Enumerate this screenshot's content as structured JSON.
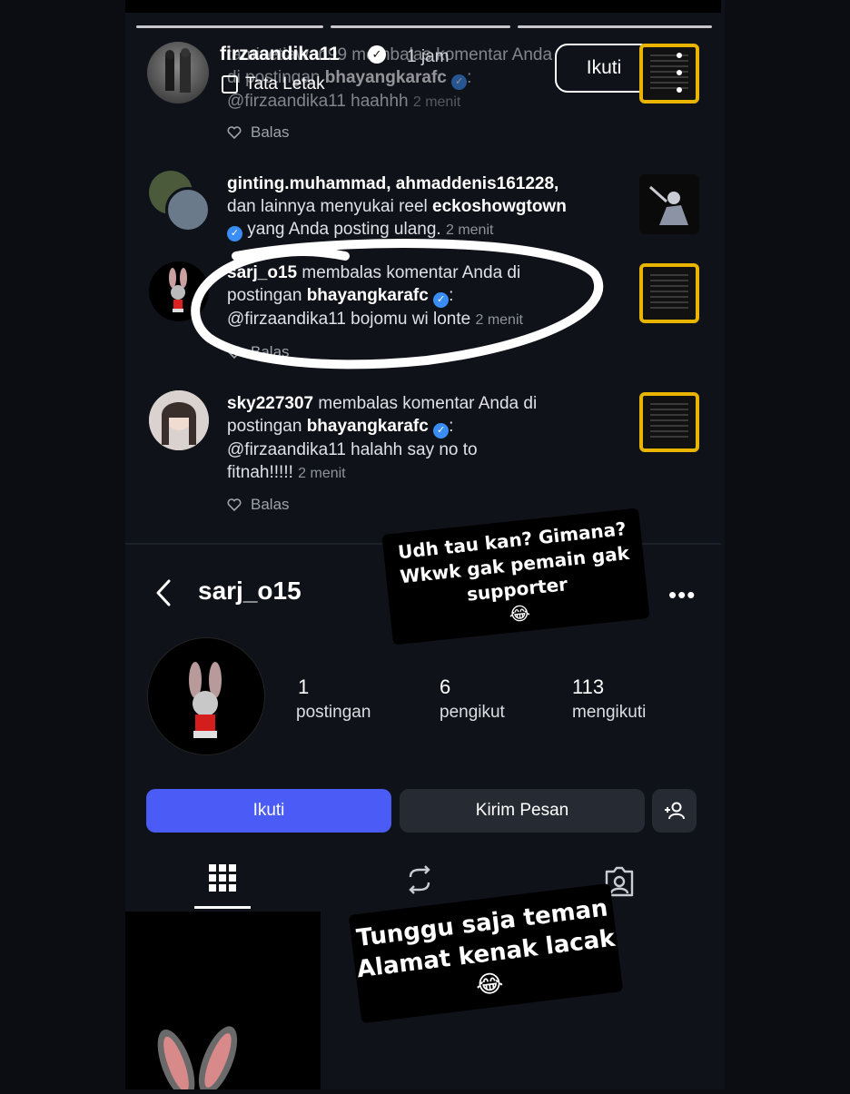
{
  "notifications": [
    {
      "overlay_username": "firzaandika11",
      "overlay_time": "1 jam",
      "overlay_layout": "Tata Letak",
      "overlay_follow": "Ikuti",
      "line1": "tamisetiawan99 membalas komentar Anda",
      "line2_prefix": "di postingan ",
      "line2_user": "bhayangkarafc",
      "line3": "@firzaandika11 haahhh",
      "time": "2 menit",
      "reply_label": "Balas"
    },
    {
      "line1_users": "ginting.muhammad, ahmaddenis161228,",
      "line2_prefix": "dan lainnya menyukai reel ",
      "line2_user": "eckoshowgtown",
      "line3": "yang Anda posting ulang.",
      "time": "2 menit"
    },
    {
      "user": "sarj_o15",
      "line1_rest": " membalas komentar Anda di",
      "line2_prefix": "postingan ",
      "line2_user": "bhayangkarafc",
      "line3": "@firzaandika11 bojomu wi lonte",
      "time": "2 menit",
      "reply_label": "Balas"
    },
    {
      "user": "sky227307",
      "line1_rest": " membalas komentar Anda di",
      "line2_prefix": "postingan ",
      "line2_user": "bhayangkarafc",
      "line3": "@firzaandika11 halahh say no to",
      "line4": "fitnah!!!!!",
      "time": "2 menit",
      "reply_label": "Balas"
    }
  ],
  "sticker1": {
    "line1": "Udh tau kan? Gimana?",
    "line2": "Wkwk gak pemain gak",
    "line3": "supporter",
    "emoji": "😂"
  },
  "profile": {
    "username": "sarj_o15",
    "posts_count": "1",
    "posts_label": "postingan",
    "followers_count": "6",
    "followers_label": "pengikut",
    "following_count": "113",
    "following_label": "mengikuti",
    "follow_button": "Ikuti",
    "message_button": "Kirim Pesan"
  },
  "sticker2": {
    "line1": "Tunggu saja teman",
    "line2": "Alamat kenak lacak",
    "emoji": "😂"
  },
  "colors": {
    "accent_blue": "#4a5cf5",
    "verified_blue": "#3a8df5",
    "highlight_yellow": "#e8b400"
  }
}
